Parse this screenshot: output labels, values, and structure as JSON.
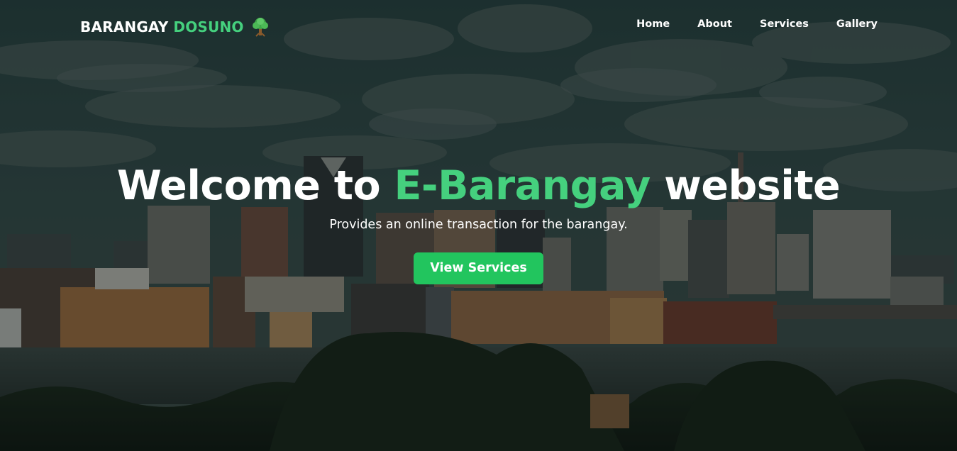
{
  "navbar": {
    "brand_main": "BARANGAY",
    "brand_accent": "DOSUNO",
    "brand_icon": "tree-icon",
    "links": [
      {
        "label": "Home"
      },
      {
        "label": "About"
      },
      {
        "label": "Services"
      },
      {
        "label": "Gallery"
      }
    ]
  },
  "hero": {
    "title_before": "Welcome to",
    "title_accent": "E-Barangay",
    "title_after": "website",
    "subtitle": "Provides an online transaction for the barangay.",
    "cta_label": "View Services"
  },
  "colors": {
    "accent": "#45d07e",
    "button": "#22c55e",
    "text": "#ffffff"
  }
}
